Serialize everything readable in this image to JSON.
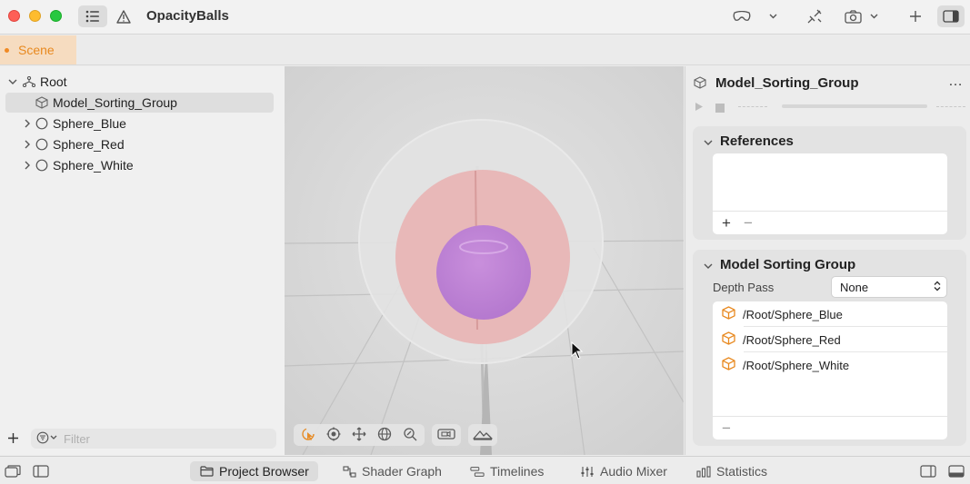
{
  "window": {
    "title": "OpacityBalls"
  },
  "tabs": {
    "active_tab": "Scene"
  },
  "hierarchy": {
    "root_label": "Root",
    "items": [
      {
        "label": "Model_Sorting_Group",
        "selected": true
      },
      {
        "label": "Sphere_Blue"
      },
      {
        "label": "Sphere_Red"
      },
      {
        "label": "Sphere_White"
      }
    ],
    "filter_placeholder": "Filter"
  },
  "inspector": {
    "title": "Model_Sorting_Group",
    "more_label": "…",
    "references": {
      "title": "References",
      "add_label": "+",
      "remove_label": "−"
    },
    "sorting": {
      "title": "Model Sorting Group",
      "depth_pass_label": "Depth Pass",
      "depth_pass_value": "None",
      "entries": [
        "/Root/Sphere_Blue",
        "/Root/Sphere_Red",
        "/Root/Sphere_White"
      ],
      "remove_label": "−"
    }
  },
  "bottom_tabs": [
    "Project Browser",
    "Shader Graph",
    "Timelines",
    "Audio Mixer",
    "Statistics"
  ],
  "colors": {
    "accent_orange": "#e8891f",
    "selection": "#dedede"
  }
}
